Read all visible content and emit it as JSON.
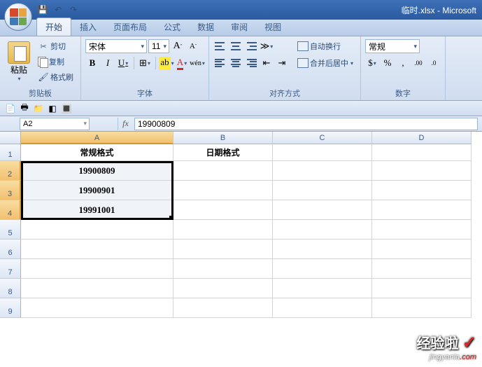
{
  "title": "临时.xlsx - Microsoft",
  "tabs": [
    "开始",
    "插入",
    "页面布局",
    "公式",
    "数据",
    "审阅",
    "视图"
  ],
  "clipboard": {
    "label": "剪贴板",
    "paste": "粘贴",
    "cut": "剪切",
    "copy": "复制",
    "format_painter": "格式刷"
  },
  "font": {
    "label": "字体",
    "name": "宋体",
    "size": "11",
    "grow": "A",
    "shrink": "A",
    "bold": "B",
    "italic": "I",
    "underline": "U"
  },
  "align": {
    "label": "对齐方式",
    "wrap": "自动换行",
    "merge": "合并后居中"
  },
  "number": {
    "label": "数字",
    "format": "常规"
  },
  "namebox": "A2",
  "fx": "fx",
  "formula": "19900809",
  "cols": [
    "A",
    "B",
    "C",
    "D"
  ],
  "rows": [
    "1",
    "2",
    "3",
    "4",
    "5",
    "6",
    "7",
    "8",
    "9"
  ],
  "headers": {
    "a": "常规格式",
    "b": "日期格式"
  },
  "data_a": [
    "19900809",
    "19900901",
    "19991001"
  ],
  "watermark": {
    "text": "经验啦",
    "url_a": "jingyanla",
    "url_b": ".com"
  }
}
